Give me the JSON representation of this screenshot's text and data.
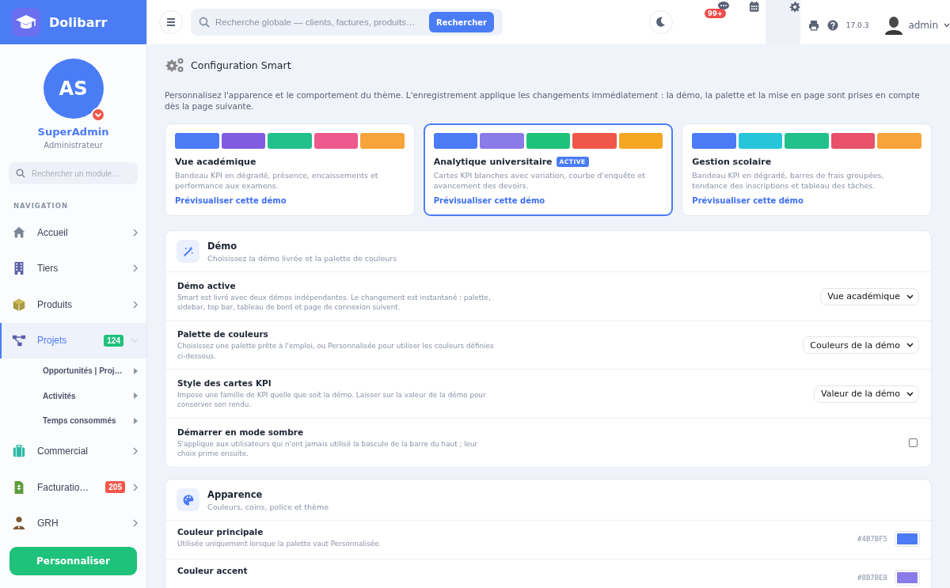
{
  "brand": {
    "name": "Dolibarr"
  },
  "topbar": {
    "search_placeholder": "Recherche globale — clients, factures, produits…",
    "search_button": "Rechercher",
    "notifications_badge": "99+",
    "version": "17.0.3",
    "user": "admin"
  },
  "profile": {
    "initials": "AS",
    "name": "SuperAdmin",
    "role": "Administrateur"
  },
  "sidebar": {
    "search_placeholder": "Rechercher un module…",
    "section": "NAVIGATION",
    "items": [
      {
        "label": "Accueil",
        "selected": false,
        "expanded": false
      },
      {
        "label": "Tiers",
        "selected": false,
        "expanded": false
      },
      {
        "label": "Produits",
        "selected": false,
        "expanded": false
      },
      {
        "label": "Projets",
        "selected": true,
        "expanded": true,
        "badge": {
          "text": "124",
          "color": "#1fc27a"
        },
        "children": [
          {
            "label": "Opportunités | Proj…"
          },
          {
            "label": "Activités"
          },
          {
            "label": "Temps consommés"
          }
        ]
      },
      {
        "label": "Commercial",
        "selected": false,
        "expanded": false
      },
      {
        "label": "Facturatio…",
        "selected": false,
        "expanded": false,
        "badge": {
          "text": "205",
          "color": "#f0574b"
        }
      },
      {
        "label": "GRH",
        "selected": false,
        "expanded": false
      }
    ],
    "button": "Personnaliser"
  },
  "page": {
    "title": "Configuration Smart",
    "intro": "Personnalisez l'apparence et le comportement du thème. L'enregistrement applique les changements immédiatement : la démo, la palette et la mise en page sont prises en compte dès la page suivante."
  },
  "demos": [
    {
      "title": "Vue académique",
      "selected": false,
      "palette": [
        {
          "color": "#4b7bf5"
        },
        {
          "color": "#7f5ce0"
        },
        {
          "color": "#22c08a"
        },
        {
          "color": "#ef5a8e"
        },
        {
          "color": "#f7a43a"
        }
      ],
      "description": "Bandeau KPI en dégradé, présence, encaissements et performance aux examens.",
      "link": "Prévisualiser cette démo"
    },
    {
      "title": "Analytique universitaire",
      "selected": true,
      "badge": "ACTIVE",
      "palette": [
        {
          "color": "#4b7bf5"
        },
        {
          "color": "#8b7be8"
        },
        {
          "color": "#1fc27a"
        },
        {
          "color": "#f0574b"
        },
        {
          "color": "#f5a623"
        }
      ],
      "description": "Cartes KPI blanches avec variation, courbe d'enquête et avancement des devoirs.",
      "link": "Prévisualiser cette démo"
    },
    {
      "title": "Gestion scolaire",
      "selected": false,
      "palette": [
        {
          "color": "#4b7bf5"
        },
        {
          "color": "#26c6da"
        },
        {
          "color": "#22c08a"
        },
        {
          "color": "#e9506a"
        },
        {
          "color": "#f7a43a"
        }
      ],
      "description": "Bandeau KPI en dégradé, barres de frais groupées, tendance des inscriptions et tableau des tâches.",
      "link": "Prévisualiser cette démo"
    }
  ],
  "sections": [
    {
      "title": "Démo",
      "subtitle": "Choisissez la démo livrée et la palette de couleurs",
      "rows": [
        {
          "kind": "select",
          "label": "Démo active",
          "description": "Smart est livré avec deux démos indépendantes. Le changement est instantané : palette, sidebar, top bar, tableau de bord et page de connexion suivent.",
          "value": "Vue académique"
        },
        {
          "kind": "select",
          "label": "Palette de couleurs",
          "description": "Choisissez une palette prête à l'emploi, ou Personnalisée pour utiliser les couleurs définies ci-dessous.",
          "value": "Couleurs de la démo"
        },
        {
          "kind": "select",
          "label": "Style des cartes KPI",
          "description": "Impose une famille de KPI quelle que soit la démo. Laisser sur la valeur de la démo pour conserver son rendu.",
          "value": "Valeur de la démo"
        },
        {
          "kind": "checkbox",
          "label": "Démarrer en mode sombre",
          "description": "S'applique aux utilisateurs qui n'ont jamais utilisé la bascule de la barre du haut ; leur choix prime ensuite.",
          "checked": false
        }
      ]
    },
    {
      "title": "Apparence",
      "subtitle": "Couleurs, coins, police et thème",
      "rows": [
        {
          "kind": "color",
          "label": "Couleur principale",
          "description": "Utilisée uniquement lorsque la palette vaut Personnalisée.",
          "value": "#4B7BF5",
          "color": "#4b7bf5"
        },
        {
          "kind": "color",
          "label": "Couleur accent",
          "value": "#8B7BE8",
          "color": "#8b7be8"
        }
      ]
    }
  ]
}
